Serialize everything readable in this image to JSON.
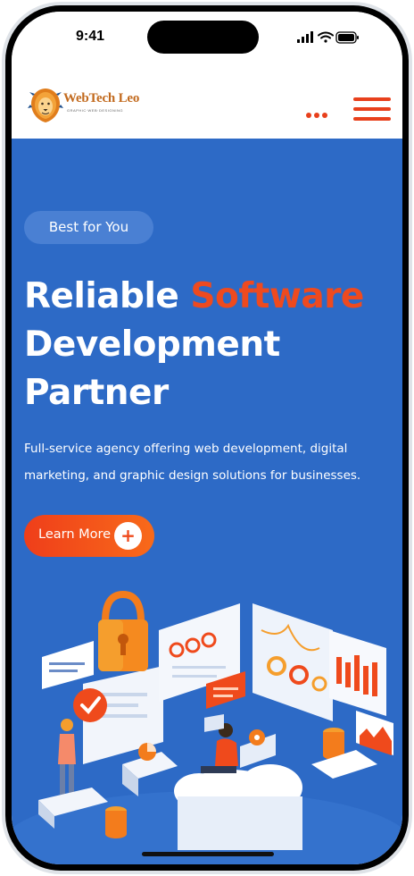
{
  "status_bar": {
    "time": "9:41",
    "icons": [
      "cellular-signal-icon",
      "wifi-icon",
      "battery-icon"
    ]
  },
  "header": {
    "logo": {
      "name": "WebTech Leo",
      "tagline": "GRAPHIC·WEB·DESIGNING",
      "icon": "lion-icon"
    },
    "more_icon": "more-dots-icon",
    "menu_icon": "hamburger-menu-icon"
  },
  "hero": {
    "badge": "Best for You",
    "title": {
      "part1": "Reliable ",
      "accent": "Software",
      "part2": "Development Partner"
    },
    "description": "Full-service agency offering web development, digital marketing, and graphic design solutions for businesses.",
    "cta": {
      "label": "Learn More",
      "icon": "plus-icon"
    }
  },
  "colors": {
    "hero_bg": "#2d6ac6",
    "accent": "#ee4a1f",
    "badge_bg": "#4a80d3",
    "text": "#ffffff"
  },
  "illustration": {
    "elements": [
      "padlock-icon",
      "checkmark-icon",
      "chat-bubble-icon",
      "bar-chart-icon",
      "cloud-icon",
      "database-icon",
      "person-with-laptop",
      "woman-presenting",
      "pie-chart-icon",
      "gear-icon"
    ]
  }
}
